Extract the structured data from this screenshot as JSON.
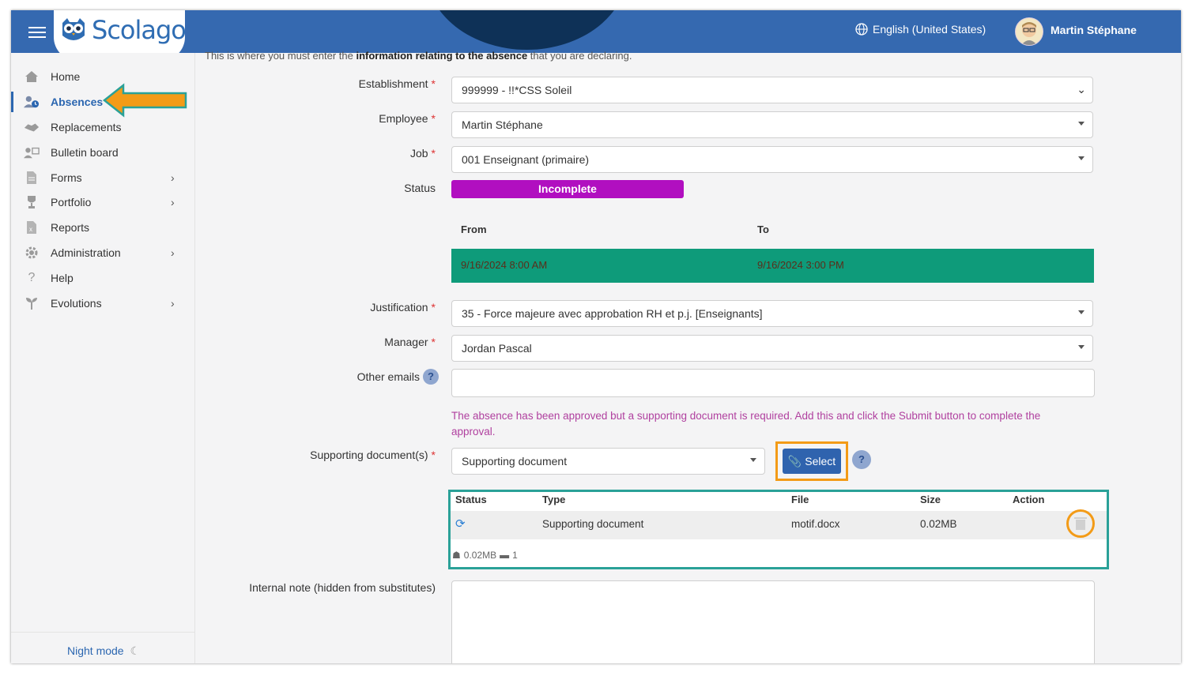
{
  "header": {
    "logo_text": "Scolago",
    "language": "English (United States)",
    "user_name": "Martin Stéphane"
  },
  "sidebar": {
    "items": [
      {
        "label": "Home",
        "icon": "home-icon"
      },
      {
        "label": "Absences",
        "icon": "person-clock-icon",
        "active": true
      },
      {
        "label": "Replacements",
        "icon": "handshake-icon"
      },
      {
        "label": "Bulletin board",
        "icon": "person-board-icon"
      },
      {
        "label": "Forms",
        "icon": "document-icon",
        "chevron": true
      },
      {
        "label": "Portfolio",
        "icon": "trophy-icon",
        "chevron": true
      },
      {
        "label": "Reports",
        "icon": "report-icon"
      },
      {
        "label": "Administration",
        "icon": "gear-icon",
        "chevron": true
      },
      {
        "label": "Help",
        "icon": "question-icon"
      },
      {
        "label": "Evolutions",
        "icon": "sprout-icon",
        "chevron": true
      }
    ],
    "night_mode": "Night mode"
  },
  "form": {
    "intro_before": "This is where you must enter the ",
    "intro_bold": "information relating to the absence",
    "intro_after": " that you are declaring.",
    "establishment_label": "Establishment",
    "establishment_value": "999999 - !!*CSS Soleil",
    "employee_label": "Employee",
    "employee_value": "Martin Stéphane",
    "job_label": "Job",
    "job_value": "001 Enseignant (primaire)",
    "status_label": "Status",
    "status_value": "Incomplete",
    "from_header": "From",
    "to_header": "To",
    "from_value": "9/16/2024 8:00 AM",
    "to_value": "9/16/2024 3:00 PM",
    "justification_label": "Justification",
    "justification_value": "35 - Force majeure avec approbation RH et p.j. [Enseignants]",
    "manager_label": "Manager",
    "manager_value": "Jordan Pascal",
    "other_emails_label": "Other emails",
    "warning": "The absence has been approved but a supporting document is required. Add this and click the Submit button to complete the approval.",
    "supporting_label": "Supporting document(s)",
    "supporting_value": "Supporting document",
    "select_button": "Select",
    "help_char": "?",
    "internal_note_label": "Internal note (hidden from substitutes)"
  },
  "documents": {
    "headers": {
      "status": "Status",
      "type": "Type",
      "file": "File",
      "size": "Size",
      "action": "Action"
    },
    "rows": [
      {
        "type": "Supporting document",
        "file": "motif.docx",
        "size": "0.02MB"
      }
    ],
    "total_size": "0.02MB",
    "file_count": "1"
  },
  "colors": {
    "topbar": "#3569b0",
    "status_incomplete": "#b10fc0",
    "date_row": "#0e9b7a",
    "highlight_orange": "#f39b17",
    "highlight_teal": "#2aa198"
  }
}
